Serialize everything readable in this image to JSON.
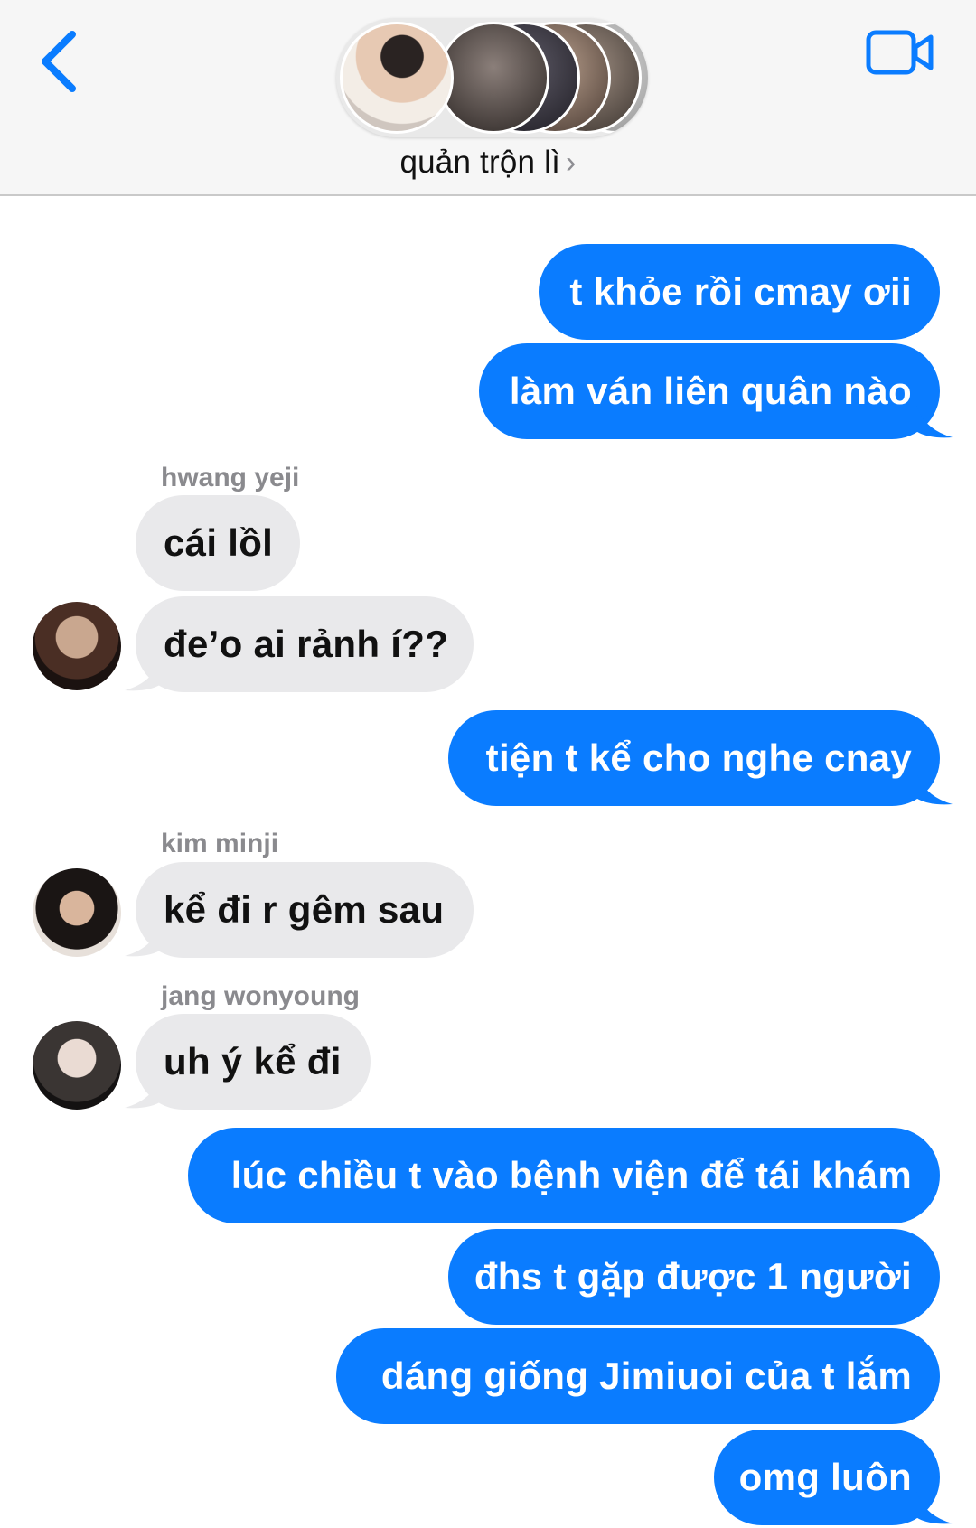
{
  "header": {
    "title": "quản trộn lì",
    "chevron": "›",
    "back_icon": "chevron-left-icon",
    "video_icon": "video-camera-icon"
  },
  "colors": {
    "outgoing_bubble": "#0a7cff",
    "incoming_bubble": "#e9e9eb",
    "accent": "#0a7cff",
    "sender_name": "#8a8a8e"
  },
  "messages": [
    {
      "text": "t khỏe rồi cmay ơii",
      "direction": "outgoing"
    },
    {
      "text": "làm ván liên quân nào",
      "direction": "outgoing"
    },
    {
      "sender": "hwang yeji",
      "text": "cái lồl",
      "direction": "incoming"
    },
    {
      "text": "đe’o ai rảnh í??",
      "direction": "incoming"
    },
    {
      "text": "tiện t kể cho nghe cnay",
      "direction": "outgoing"
    },
    {
      "sender": "kim minji",
      "text": "kể đi r gêm sau",
      "direction": "incoming"
    },
    {
      "sender": "jang wonyoung",
      "text": "uh ý kể đi",
      "direction": "incoming"
    },
    {
      "text": "lúc chiều t vào bệnh viện để tái khám",
      "direction": "outgoing"
    },
    {
      "text": "đhs t gặp được 1 người",
      "direction": "outgoing"
    },
    {
      "text": "dáng  giống Jimiuoi của t lắm",
      "direction": "outgoing"
    },
    {
      "text": "omg luôn",
      "direction": "outgoing"
    }
  ]
}
